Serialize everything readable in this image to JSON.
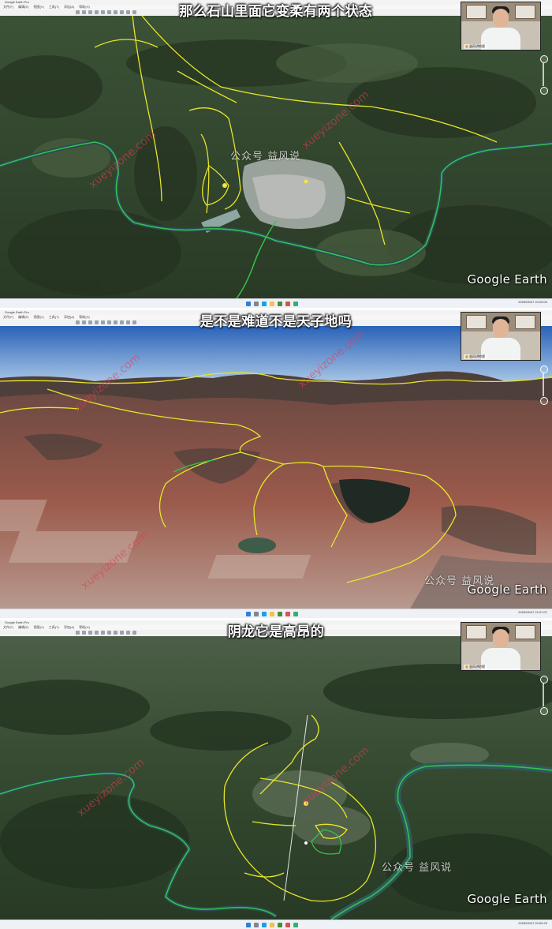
{
  "app": {
    "title": "Google Earth Pro",
    "menu": [
      "文件(F)",
      "编辑(E)",
      "视图(V)",
      "工具(T)",
      "添加(A)",
      "帮助(H)"
    ]
  },
  "watermark": {
    "account": "公众号 益风说",
    "url": "xueyizone.com"
  },
  "logo": "Google Earth",
  "webcam_caption": "益风讲地理",
  "panels": [
    {
      "subtitle": "那么石山里面它变柔有两个状态",
      "clock": "2025/05/07 20:26:00"
    },
    {
      "subtitle": "是不是难道不是天子地吗",
      "clock": "2025/05/07 22:07:07"
    },
    {
      "subtitle": "阴龙它是高昂的",
      "clock": "2025/05/07 20:59:29"
    }
  ],
  "colors": {
    "ridge_line": "#e6e62a",
    "river_line": "#35c24a",
    "terrain_green": "#34492f",
    "red_soil": "#9b5a4b",
    "sky": "#2f6fc2"
  },
  "taskbar_icons": [
    "start-icon",
    "search-icon",
    "browser-icon",
    "folder-icon",
    "earth-icon",
    "video-icon",
    "chat-icon"
  ]
}
